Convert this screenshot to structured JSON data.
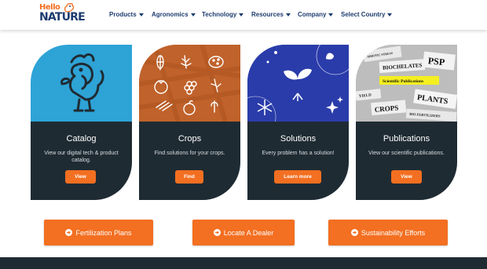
{
  "brand": {
    "hello": "Hello",
    "nature": "NATURE",
    "tm": "®"
  },
  "nav": [
    {
      "label": "Products",
      "icon": "chevron-down-icon"
    },
    {
      "label": "Agronomics",
      "icon": "chevron-down-icon"
    },
    {
      "label": "Technology",
      "icon": "chevron-down-icon"
    },
    {
      "label": "Resources",
      "icon": "chevron-down-icon"
    },
    {
      "label": "Company",
      "icon": "chevron-down-icon"
    },
    {
      "label": "Select Country",
      "icon": "chevron-down-icon"
    }
  ],
  "cards": [
    {
      "title": "Catalog",
      "desc": "View our digital tech & product catalog.",
      "button": "View",
      "image": "rooster-icon",
      "bg": "#2ea3d6"
    },
    {
      "title": "Crops",
      "desc": "Find solutions for your crops.",
      "button": "Find",
      "image": "crops-icons",
      "bg": "#c6642a"
    },
    {
      "title": "Solutions",
      "desc": "Every problem has a solution!",
      "button": "Learn more",
      "image": "sprout-icon",
      "bg": "#2c3fb0"
    },
    {
      "title": "Publications",
      "desc": "View our scientific publications.",
      "button": "View",
      "image": "newspaper-clippings",
      "clippings": [
        "PSP",
        "BIOCHELATES",
        "Scientific Publications",
        "CROPS",
        "PLANTS",
        "YIELD",
        "ABIOTIC STRESS",
        "BIO FERTILIZERS"
      ]
    }
  ],
  "ctas": [
    {
      "label": "Fertilization Plans",
      "icon": "arrow-circle-right-icon"
    },
    {
      "label": "Locate A Dealer",
      "icon": "arrow-circle-right-icon"
    },
    {
      "label": "Sustainability Efforts",
      "icon": "arrow-circle-right-icon"
    }
  ],
  "colors": {
    "accent": "#f36f21",
    "navy": "#1d3c6e",
    "dark": "#1f2b33"
  }
}
